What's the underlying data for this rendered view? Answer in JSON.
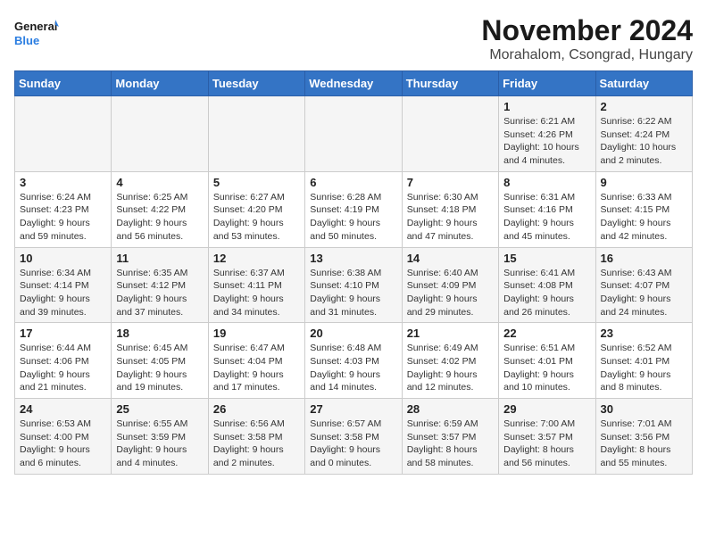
{
  "header": {
    "logo_text_general": "General",
    "logo_text_blue": "Blue",
    "month": "November 2024",
    "location": "Morahalom, Csongrad, Hungary"
  },
  "days_of_week": [
    "Sunday",
    "Monday",
    "Tuesday",
    "Wednesday",
    "Thursday",
    "Friday",
    "Saturday"
  ],
  "weeks": [
    [
      {
        "day": "",
        "info": ""
      },
      {
        "day": "",
        "info": ""
      },
      {
        "day": "",
        "info": ""
      },
      {
        "day": "",
        "info": ""
      },
      {
        "day": "",
        "info": ""
      },
      {
        "day": "1",
        "info": "Sunrise: 6:21 AM\nSunset: 4:26 PM\nDaylight: 10 hours and 4 minutes."
      },
      {
        "day": "2",
        "info": "Sunrise: 6:22 AM\nSunset: 4:24 PM\nDaylight: 10 hours and 2 minutes."
      }
    ],
    [
      {
        "day": "3",
        "info": "Sunrise: 6:24 AM\nSunset: 4:23 PM\nDaylight: 9 hours and 59 minutes."
      },
      {
        "day": "4",
        "info": "Sunrise: 6:25 AM\nSunset: 4:22 PM\nDaylight: 9 hours and 56 minutes."
      },
      {
        "day": "5",
        "info": "Sunrise: 6:27 AM\nSunset: 4:20 PM\nDaylight: 9 hours and 53 minutes."
      },
      {
        "day": "6",
        "info": "Sunrise: 6:28 AM\nSunset: 4:19 PM\nDaylight: 9 hours and 50 minutes."
      },
      {
        "day": "7",
        "info": "Sunrise: 6:30 AM\nSunset: 4:18 PM\nDaylight: 9 hours and 47 minutes."
      },
      {
        "day": "8",
        "info": "Sunrise: 6:31 AM\nSunset: 4:16 PM\nDaylight: 9 hours and 45 minutes."
      },
      {
        "day": "9",
        "info": "Sunrise: 6:33 AM\nSunset: 4:15 PM\nDaylight: 9 hours and 42 minutes."
      }
    ],
    [
      {
        "day": "10",
        "info": "Sunrise: 6:34 AM\nSunset: 4:14 PM\nDaylight: 9 hours and 39 minutes."
      },
      {
        "day": "11",
        "info": "Sunrise: 6:35 AM\nSunset: 4:12 PM\nDaylight: 9 hours and 37 minutes."
      },
      {
        "day": "12",
        "info": "Sunrise: 6:37 AM\nSunset: 4:11 PM\nDaylight: 9 hours and 34 minutes."
      },
      {
        "day": "13",
        "info": "Sunrise: 6:38 AM\nSunset: 4:10 PM\nDaylight: 9 hours and 31 minutes."
      },
      {
        "day": "14",
        "info": "Sunrise: 6:40 AM\nSunset: 4:09 PM\nDaylight: 9 hours and 29 minutes."
      },
      {
        "day": "15",
        "info": "Sunrise: 6:41 AM\nSunset: 4:08 PM\nDaylight: 9 hours and 26 minutes."
      },
      {
        "day": "16",
        "info": "Sunrise: 6:43 AM\nSunset: 4:07 PM\nDaylight: 9 hours and 24 minutes."
      }
    ],
    [
      {
        "day": "17",
        "info": "Sunrise: 6:44 AM\nSunset: 4:06 PM\nDaylight: 9 hours and 21 minutes."
      },
      {
        "day": "18",
        "info": "Sunrise: 6:45 AM\nSunset: 4:05 PM\nDaylight: 9 hours and 19 minutes."
      },
      {
        "day": "19",
        "info": "Sunrise: 6:47 AM\nSunset: 4:04 PM\nDaylight: 9 hours and 17 minutes."
      },
      {
        "day": "20",
        "info": "Sunrise: 6:48 AM\nSunset: 4:03 PM\nDaylight: 9 hours and 14 minutes."
      },
      {
        "day": "21",
        "info": "Sunrise: 6:49 AM\nSunset: 4:02 PM\nDaylight: 9 hours and 12 minutes."
      },
      {
        "day": "22",
        "info": "Sunrise: 6:51 AM\nSunset: 4:01 PM\nDaylight: 9 hours and 10 minutes."
      },
      {
        "day": "23",
        "info": "Sunrise: 6:52 AM\nSunset: 4:01 PM\nDaylight: 9 hours and 8 minutes."
      }
    ],
    [
      {
        "day": "24",
        "info": "Sunrise: 6:53 AM\nSunset: 4:00 PM\nDaylight: 9 hours and 6 minutes."
      },
      {
        "day": "25",
        "info": "Sunrise: 6:55 AM\nSunset: 3:59 PM\nDaylight: 9 hours and 4 minutes."
      },
      {
        "day": "26",
        "info": "Sunrise: 6:56 AM\nSunset: 3:58 PM\nDaylight: 9 hours and 2 minutes."
      },
      {
        "day": "27",
        "info": "Sunrise: 6:57 AM\nSunset: 3:58 PM\nDaylight: 9 hours and 0 minutes."
      },
      {
        "day": "28",
        "info": "Sunrise: 6:59 AM\nSunset: 3:57 PM\nDaylight: 8 hours and 58 minutes."
      },
      {
        "day": "29",
        "info": "Sunrise: 7:00 AM\nSunset: 3:57 PM\nDaylight: 8 hours and 56 minutes."
      },
      {
        "day": "30",
        "info": "Sunrise: 7:01 AM\nSunset: 3:56 PM\nDaylight: 8 hours and 55 minutes."
      }
    ]
  ]
}
